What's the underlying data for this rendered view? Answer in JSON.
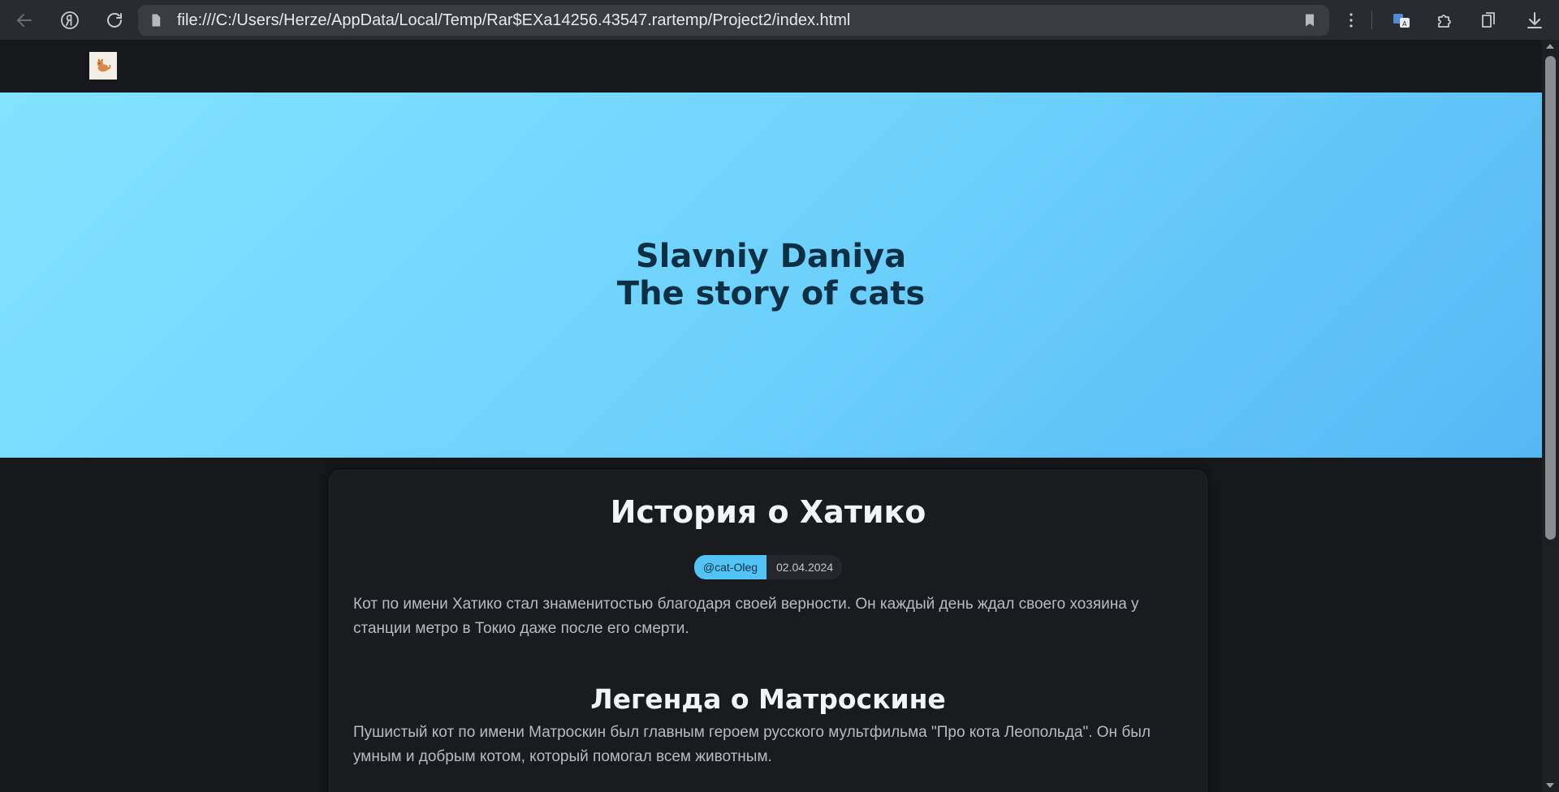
{
  "browser": {
    "url": "file:///C:/Users/Herze/AppData/Local/Temp/Rar$EXa14256.43547.rartemp/Project2/index.html",
    "back_icon": "arrow-left-icon",
    "yandex_icon": "yandex-logo-icon",
    "reload_icon": "reload-icon",
    "bookmark_icon": "bookmark-icon",
    "menu_icon": "more-vertical-icon",
    "extensions_icon": "puzzle-icon",
    "collections_icon": "collections-icon",
    "download_icon": "download-icon"
  },
  "site": {
    "logo_icon": "cat-logo-icon"
  },
  "hero": {
    "line1": "Slavniy Daniya",
    "line2": "The story of cats",
    "gradient_start": "#82e3ff",
    "gradient_end": "#56b8f3"
  },
  "article": {
    "title": "История о Хатико",
    "author": "@cat-Oleg",
    "date": "02.04.2024",
    "paragraph1": "Кот по имени Хатико стал знаменитостью благодаря своей верности. Он каждый день ждал своего хозяина у станции метро в Токио даже после его смерти.",
    "subtitle": "Легенда о Матроскине",
    "paragraph2": "Пушистый кот по имени Матроскин был главным героем русского мультфильма \"Про кота Леопольда\". Он был умным и добрым котом, который помогал всем животным."
  },
  "colors": {
    "accent": "#52c3f5",
    "background": "#17181c",
    "card": "#1a1b1f"
  }
}
